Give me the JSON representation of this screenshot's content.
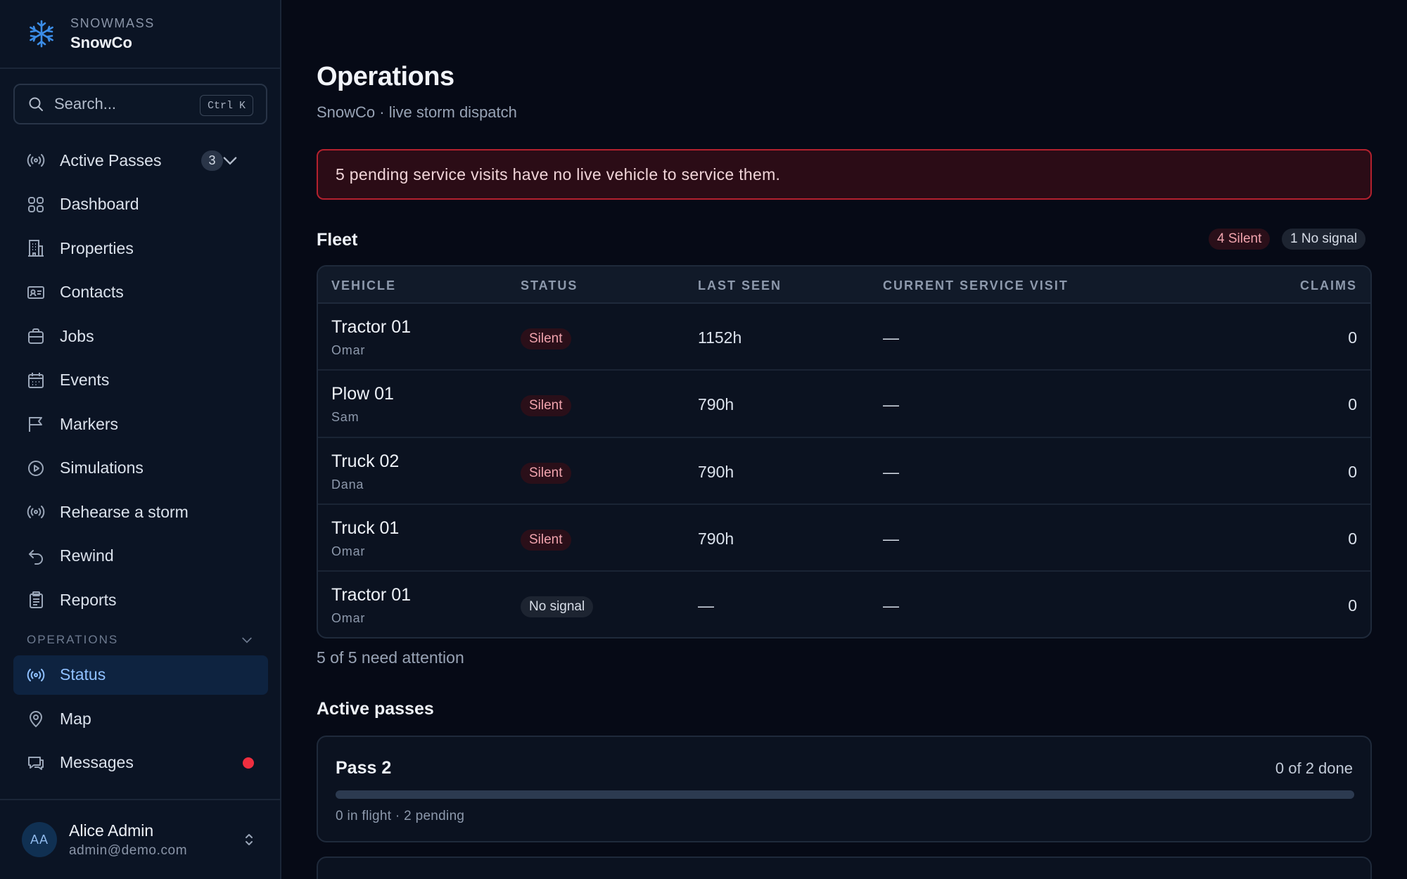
{
  "brand": {
    "org": "SNOWMASS",
    "name": "SnowCo"
  },
  "search": {
    "placeholder": "Search...",
    "shortcut": "Ctrl K"
  },
  "nav": {
    "active_passes": {
      "label": "Active Passes",
      "count": "3"
    },
    "items": [
      {
        "label": "Dashboard",
        "icon": "grid-icon"
      },
      {
        "label": "Properties",
        "icon": "building-icon"
      },
      {
        "label": "Contacts",
        "icon": "id-card-icon"
      },
      {
        "label": "Jobs",
        "icon": "briefcase-icon"
      },
      {
        "label": "Events",
        "icon": "calendar-icon"
      },
      {
        "label": "Markers",
        "icon": "flag-icon"
      },
      {
        "label": "Simulations",
        "icon": "play-circle-icon"
      },
      {
        "label": "Rehearse a storm",
        "icon": "broadcast-icon"
      },
      {
        "label": "Rewind",
        "icon": "undo-icon"
      },
      {
        "label": "Reports",
        "icon": "clipboard-icon"
      }
    ],
    "section_label": "OPERATIONS",
    "operations": [
      {
        "label": "Status",
        "icon": "broadcast-icon",
        "active": true
      },
      {
        "label": "Map",
        "icon": "map-pin-icon"
      },
      {
        "label": "Messages",
        "icon": "chat-icon",
        "unread": true
      }
    ]
  },
  "user": {
    "initials": "AA",
    "name": "Alice Admin",
    "email": "admin@demo.com"
  },
  "page": {
    "title": "Operations",
    "subtitle": "SnowCo · live storm dispatch"
  },
  "alert": {
    "text": "5 pending service visits have no live vehicle to service them."
  },
  "fleet": {
    "title": "Fleet",
    "badges": {
      "silent": "4 Silent",
      "no_signal": "1 No signal"
    },
    "columns": [
      "VEHICLE",
      "STATUS",
      "LAST SEEN",
      "CURRENT SERVICE VISIT",
      "CLAIMS"
    ],
    "rows": [
      {
        "vehicle": "Tractor 01",
        "driver": "Omar",
        "status": "Silent",
        "last_seen": "1152h",
        "visit": "—",
        "claims": "0"
      },
      {
        "vehicle": "Plow 01",
        "driver": "Sam",
        "status": "Silent",
        "last_seen": "790h",
        "visit": "—",
        "claims": "0"
      },
      {
        "vehicle": "Truck 02",
        "driver": "Dana",
        "status": "Silent",
        "last_seen": "790h",
        "visit": "—",
        "claims": "0"
      },
      {
        "vehicle": "Truck 01",
        "driver": "Omar",
        "status": "Silent",
        "last_seen": "790h",
        "visit": "—",
        "claims": "0"
      },
      {
        "vehicle": "Tractor 01",
        "driver": "Omar",
        "status": "No signal",
        "last_seen": "—",
        "visit": "—",
        "claims": "0"
      }
    ],
    "footer": "5 of 5 need attention"
  },
  "active_passes": {
    "title": "Active passes",
    "passes": [
      {
        "name": "Pass 2",
        "done_label": "0 of 2 done",
        "progress": 0,
        "meta": "0 in flight · 2 pending"
      }
    ]
  },
  "colors": {
    "accent": "#8fc0ff",
    "danger": "#ef2e3f",
    "alert_border": "#b3212e"
  }
}
